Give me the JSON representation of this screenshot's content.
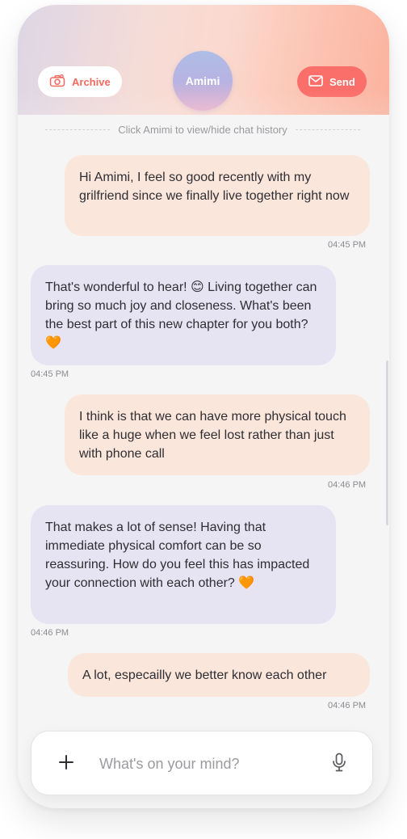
{
  "header": {
    "archive_label": "Archive",
    "send_label": "Send",
    "avatar_name": "Amimi"
  },
  "history_hint": "Click Amimi to view/hide chat history",
  "messages": [
    {
      "role": "user",
      "text": "Hi Amimi, I feel so good recently with my grilfriend since we finally live together right now",
      "time": "04:45 PM"
    },
    {
      "role": "bot",
      "text": "That's wonderful to hear! 😊 Living together can bring so much joy and closeness. What's been the best part of this new chapter for you both? 🧡",
      "time": "04:45 PM"
    },
    {
      "role": "user",
      "text": "I think is that we can have more physical touch like a huge when we feel lost rather than just with phone call",
      "time": "04:46 PM"
    },
    {
      "role": "bot",
      "text": "That makes a lot of sense! Having that immediate physical comfort can be so reassuring. How do you feel this has impacted your connection with each other? 🧡",
      "time": "04:46 PM"
    },
    {
      "role": "user",
      "text": "A lot, especailly we better know each other",
      "time": "04:46 PM"
    }
  ],
  "composer": {
    "placeholder": "What's on your mind?",
    "value": ""
  },
  "colors": {
    "accent": "#fb6f6a",
    "user_bubble": "#fbe6db",
    "bot_bubble": "#e6e3f3"
  },
  "icons": {
    "archive": "archive-camera-icon",
    "send": "envelope-icon",
    "add": "plus-icon",
    "voice": "microphone-icon"
  }
}
